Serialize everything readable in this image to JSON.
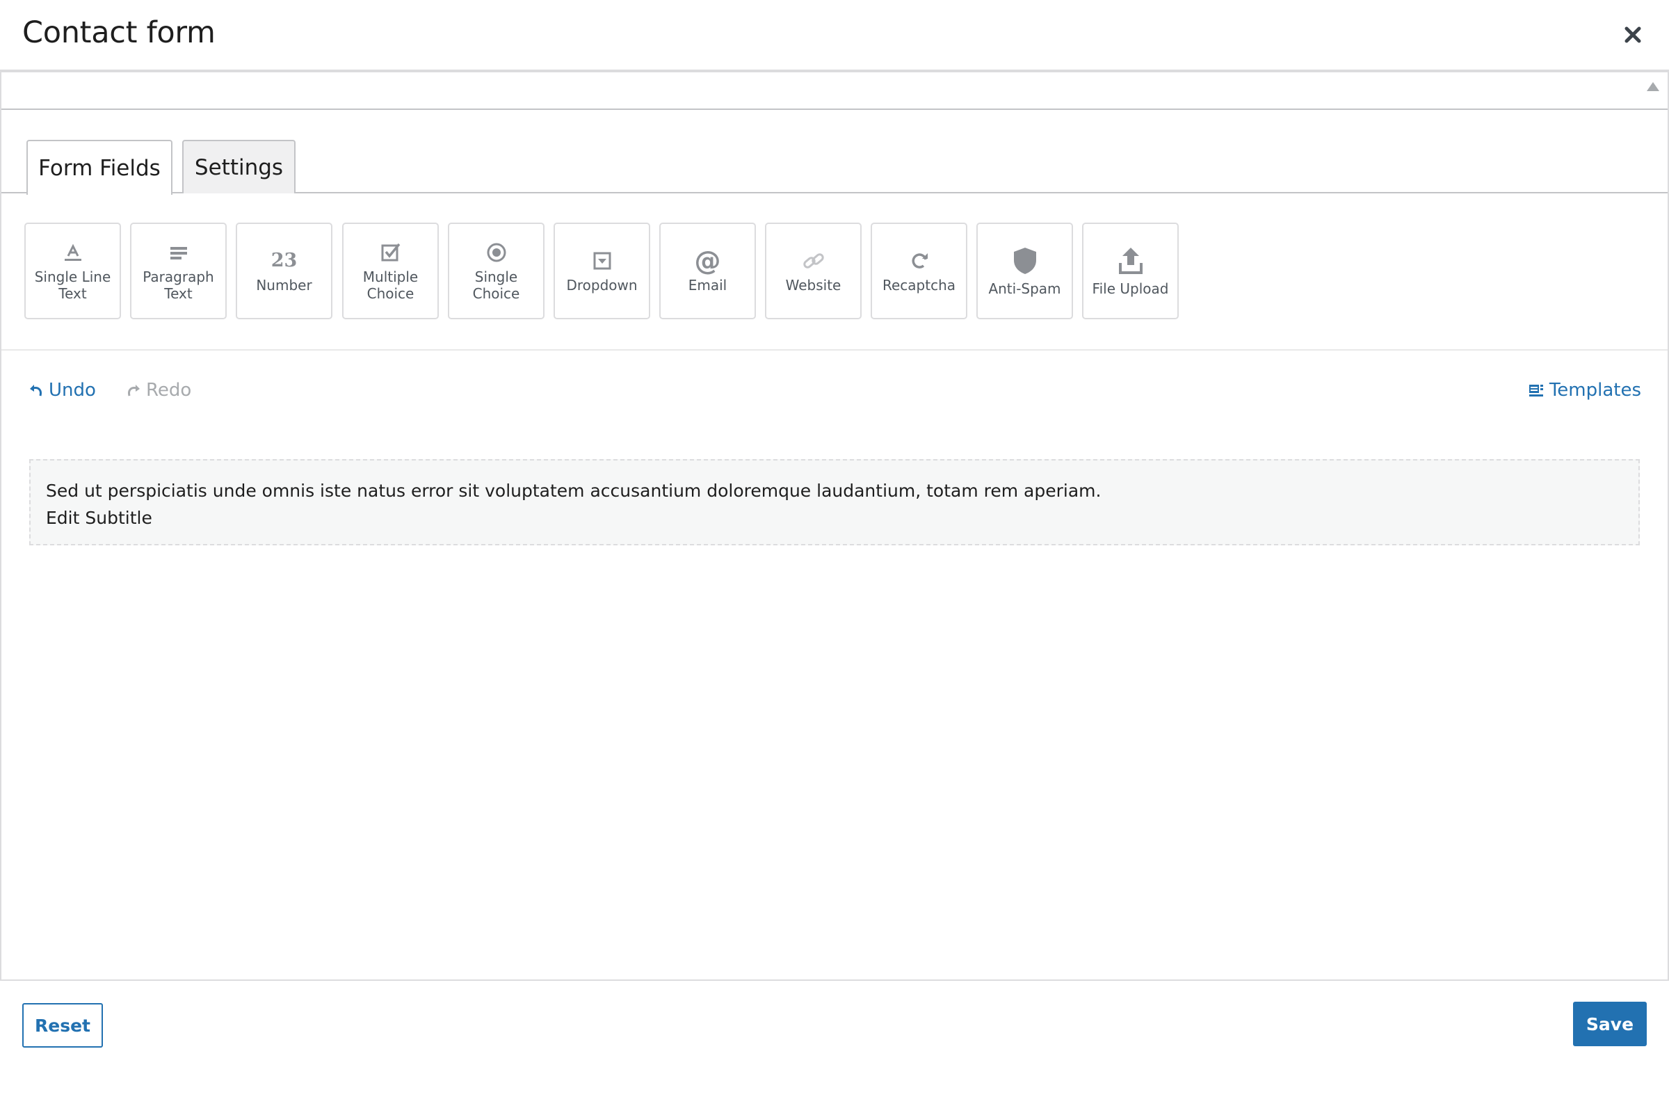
{
  "dialog": {
    "title": "Contact form",
    "close_icon": "close-icon"
  },
  "tabs": [
    {
      "label": "Form Fields",
      "active": true
    },
    {
      "label": "Settings",
      "active": false
    }
  ],
  "fields": [
    {
      "label": "Single Line Text",
      "icon": "text-field-icon"
    },
    {
      "label": "Paragraph Text",
      "icon": "paragraph-icon"
    },
    {
      "label": "Number",
      "icon": "number-icon"
    },
    {
      "label": "Multiple Choice",
      "icon": "checkbox-icon"
    },
    {
      "label": "Single Choice",
      "icon": "radio-icon"
    },
    {
      "label": "Dropdown",
      "icon": "dropdown-icon"
    },
    {
      "label": "Email",
      "icon": "at-icon"
    },
    {
      "label": "Website",
      "icon": "link-icon"
    },
    {
      "label": "Recaptcha",
      "icon": "refresh-icon"
    },
    {
      "label": "Anti-Spam",
      "icon": "shield-icon"
    },
    {
      "label": "File Upload",
      "icon": "upload-icon"
    }
  ],
  "number_icon_text": "23",
  "toolbar": {
    "undo_label": "Undo",
    "redo_label": "Redo",
    "templates_label": "Templates"
  },
  "content": {
    "description": "Sed ut perspiciatis unde omnis iste natus error sit voluptatem accusantium doloremque laudantium, totam rem aperiam.",
    "subtitle": "Edit Subtitle"
  },
  "footer": {
    "reset_label": "Reset",
    "save_label": "Save"
  },
  "colors": {
    "accent": "#2271b1",
    "border": "#dcdcde",
    "disabled": "#a7aaad",
    "icon": "#8c8f94"
  }
}
